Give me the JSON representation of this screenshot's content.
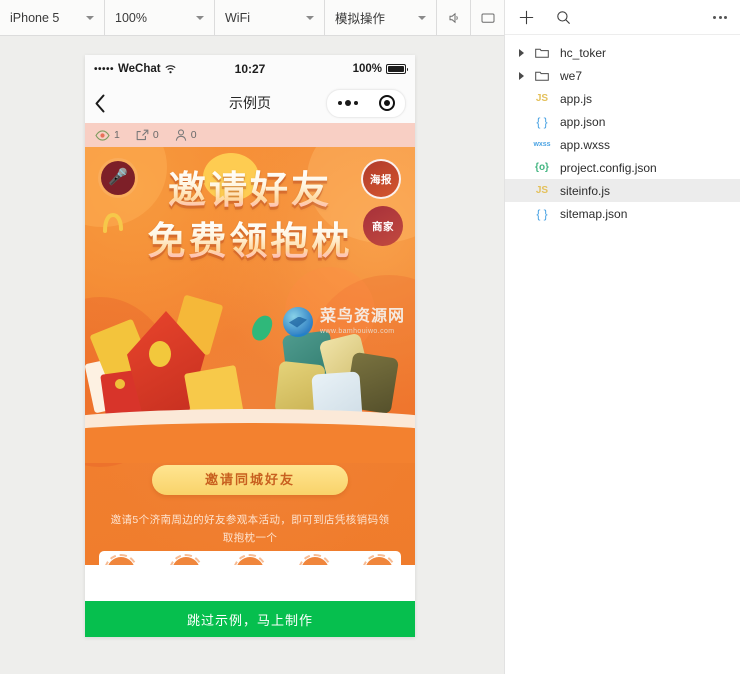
{
  "simulator": {
    "toolbar": {
      "device": "iPhone 5",
      "zoom": "100%",
      "network": "WiFi",
      "mode": "模拟操作",
      "sound_icon": "speaker-icon",
      "screen_icon": "display-icon"
    },
    "status_bar": {
      "signal": "•••••",
      "carrier": "WeChat",
      "time": "10:27",
      "battery_percent": "100%"
    },
    "nav_bar": {
      "back_icon": "chevron-left-icon",
      "title": "示例页",
      "menu_icon": "more-dots-icon",
      "target_icon": "capsule-target-icon"
    },
    "stats": [
      {
        "icon": "eye-icon",
        "value": "1"
      },
      {
        "icon": "share-icon",
        "value": "0"
      },
      {
        "icon": "person-icon",
        "value": "0"
      }
    ],
    "poster": {
      "mic_icon": "microphone-icon",
      "badges": [
        "海报",
        "商家"
      ],
      "headline_line1": "邀请好友",
      "headline_line2": "免费领抱枕",
      "cta_label": "邀请同城好友",
      "description": "邀请5个济南周边的好友参观本活动，即可到店凭核销码领取抱枕一个",
      "slot_icon": "plus-icon",
      "slot_count": 5,
      "watermark_title": "菜鸟资源网",
      "watermark_url": "www.bamhouiwo.com",
      "colors": {
        "orange": "#f3812f",
        "yellow_button": "#f9d36a",
        "green_footer": "#06bf4e",
        "stats_bar": "#f8cfc4"
      }
    },
    "footer_cta": "跳过示例，马上制作"
  },
  "files": {
    "toolbar": {
      "add_icon": "plus-icon",
      "search_icon": "search-icon",
      "more_icon": "more-dots-icon"
    },
    "tree": [
      {
        "name": "hc_toker",
        "kind": "folder",
        "icon": "folder-icon",
        "expandable": true,
        "selected": false
      },
      {
        "name": "we7",
        "kind": "folder",
        "icon": "folder-icon",
        "expandable": true,
        "selected": false
      },
      {
        "name": "app.js",
        "kind": "js",
        "icon": "js-file-icon",
        "label": "JS",
        "expandable": false,
        "selected": false
      },
      {
        "name": "app.json",
        "kind": "json",
        "icon": "json-file-icon",
        "label": "{ }",
        "expandable": false,
        "selected": false
      },
      {
        "name": "app.wxss",
        "kind": "wxss",
        "icon": "wxss-file-icon",
        "label": "wxss",
        "expandable": false,
        "selected": false
      },
      {
        "name": "project.config.json",
        "kind": "config",
        "icon": "config-file-icon",
        "label": "{o}",
        "expandable": false,
        "selected": false
      },
      {
        "name": "siteinfo.js",
        "kind": "js",
        "icon": "js-file-icon",
        "label": "JS",
        "expandable": false,
        "selected": true
      },
      {
        "name": "sitemap.json",
        "kind": "json",
        "icon": "json-file-icon",
        "label": "{ }",
        "expandable": false,
        "selected": false
      }
    ]
  }
}
